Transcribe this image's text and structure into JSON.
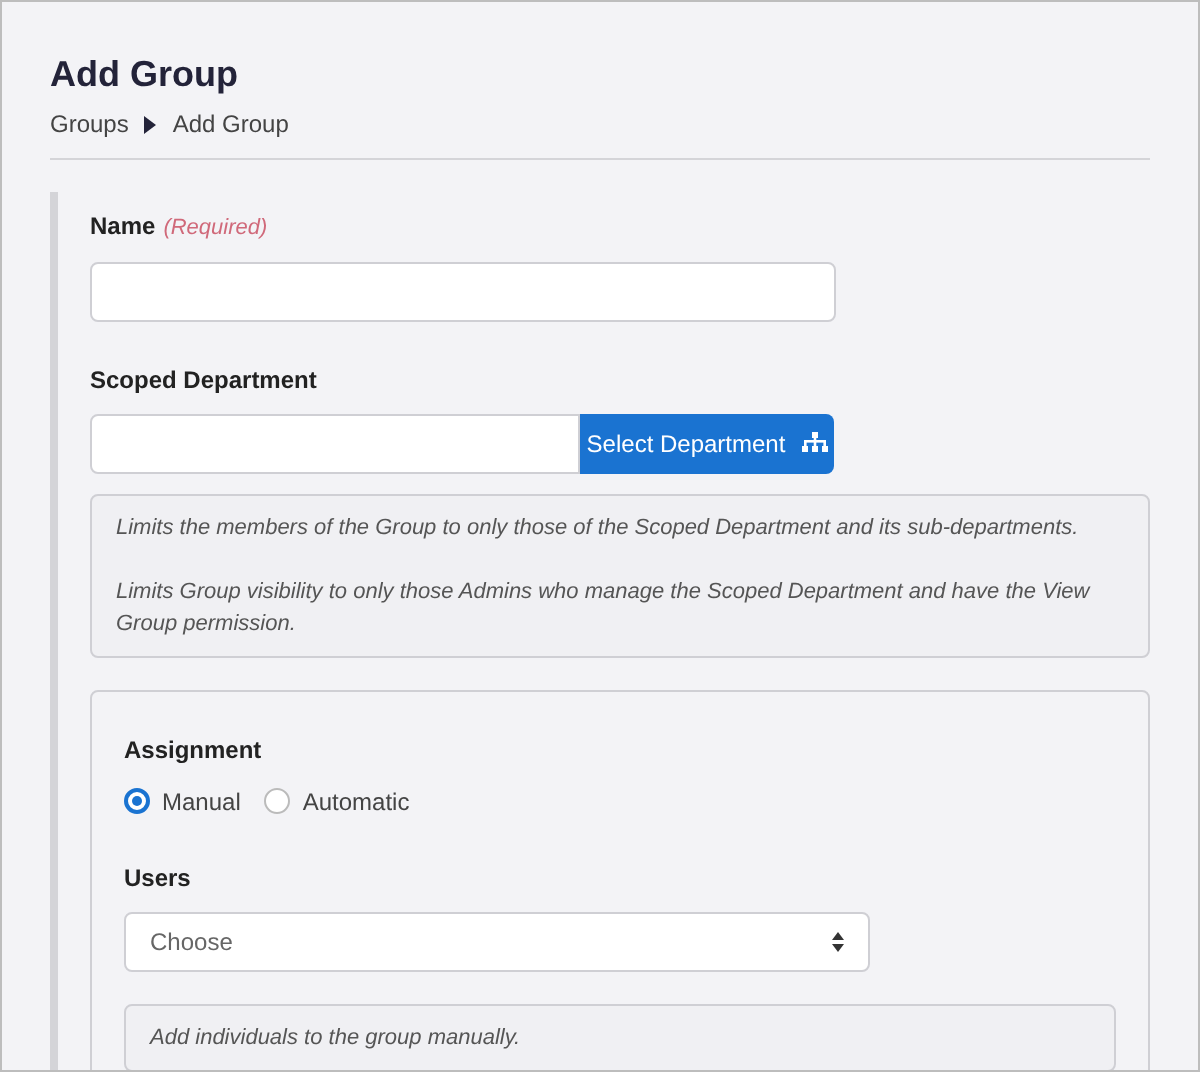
{
  "page_title": "Add Group",
  "breadcrumb": [
    {
      "label": "Groups"
    },
    {
      "label": "Add Group"
    }
  ],
  "name_field": {
    "label": "Name",
    "required_note": "(Required)"
  },
  "scoped_department": {
    "label": "Scoped Department",
    "button": "Select Department",
    "help": [
      "Limits the members of the Group to only those of the Scoped Department and its sub-departments.",
      "Limits Group visibility to only those Admins who manage the Scoped Department and have the View Group permission."
    ]
  },
  "assignment": {
    "label": "Assignment",
    "options": [
      {
        "label": "Manual",
        "selected": true
      },
      {
        "label": "Automatic",
        "selected": false
      }
    ]
  },
  "users": {
    "label": "Users",
    "placeholder": "Choose",
    "help": "Add individuals to the group manually."
  }
}
